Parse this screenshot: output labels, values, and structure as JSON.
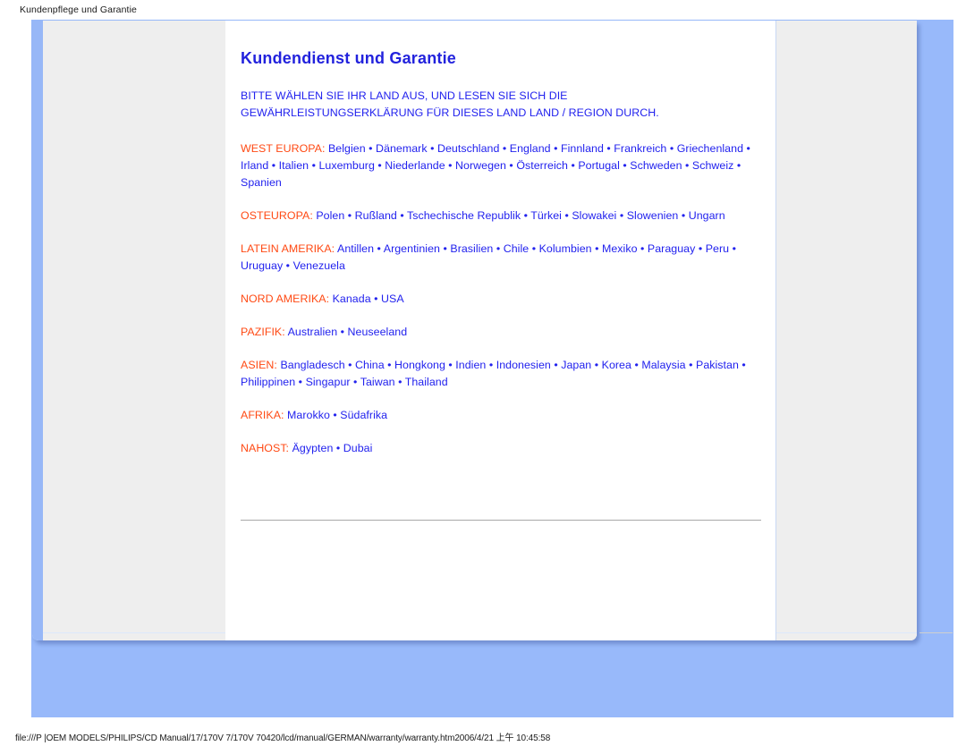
{
  "browser": {
    "header_title": "Kundenpflege und Garantie",
    "footer_path": "file:///P |OEM MODELS/PHILIPS/CD Manual/17/170V 7/170V 70420/lcd/manual/GERMAN/warranty/warranty.htm2006/4/21 上午 10:45:58"
  },
  "colors": {
    "page_backdrop": "#98b9fa",
    "title_blue": "#2222dd",
    "link_blue": "#2222ee",
    "region_orange": "#ff4a14",
    "gutter_gray": "#eeeeee"
  },
  "document": {
    "title": "Kundendienst und Garantie",
    "intro_line_1": "BITTE WÄHLEN SIE IHR LAND AUS, UND LESEN SIE SICH DIE",
    "intro_line_2": "GEWÄHRLEISTUNGSERKLÄRUNG FÜR DIESES LAND LAND / REGION DURCH.",
    "separator": "•",
    "regions": [
      {
        "label": "WEST EUROPA:",
        "countries": [
          "Belgien",
          "Dänemark",
          "Deutschland",
          "England",
          "Finnland",
          "Frankreich",
          "Griechenland",
          "Irland",
          "Italien",
          "Luxemburg",
          "Niederlande",
          "Norwegen",
          "Österreich",
          "Portugal",
          "Schweden",
          "Schweiz",
          "Spanien"
        ]
      },
      {
        "label": "OSTEUROPA:",
        "countries": [
          "Polen",
          "Rußland",
          "Tschechische Republik",
          "Türkei",
          "Slowakei",
          "Slowenien",
          "Ungarn"
        ]
      },
      {
        "label": "LATEIN AMERIKA:",
        "countries": [
          "Antillen",
          "Argentinien",
          "Brasilien",
          "Chile",
          "Kolumbien",
          "Mexiko",
          "Paraguay",
          "Peru",
          "Uruguay",
          "Venezuela"
        ]
      },
      {
        "label": "NORD AMERIKA:",
        "countries": [
          "Kanada",
          "USA"
        ]
      },
      {
        "label": "PAZIFIK:",
        "countries": [
          "Australien",
          "Neuseeland"
        ]
      },
      {
        "label": "ASIEN:",
        "countries": [
          "Bangladesch",
          "China",
          "Hongkong",
          "Indien",
          "Indonesien",
          "Japan",
          "Korea",
          "Malaysia",
          "Pakistan",
          "Philippinen",
          "Singapur",
          "Taiwan",
          "Thailand"
        ]
      },
      {
        "label": "AFRIKA:",
        "countries": [
          "Marokko",
          "Südafrika"
        ]
      },
      {
        "label": "NAHOST:",
        "countries": [
          "Ägypten",
          "Dubai"
        ]
      }
    ]
  }
}
